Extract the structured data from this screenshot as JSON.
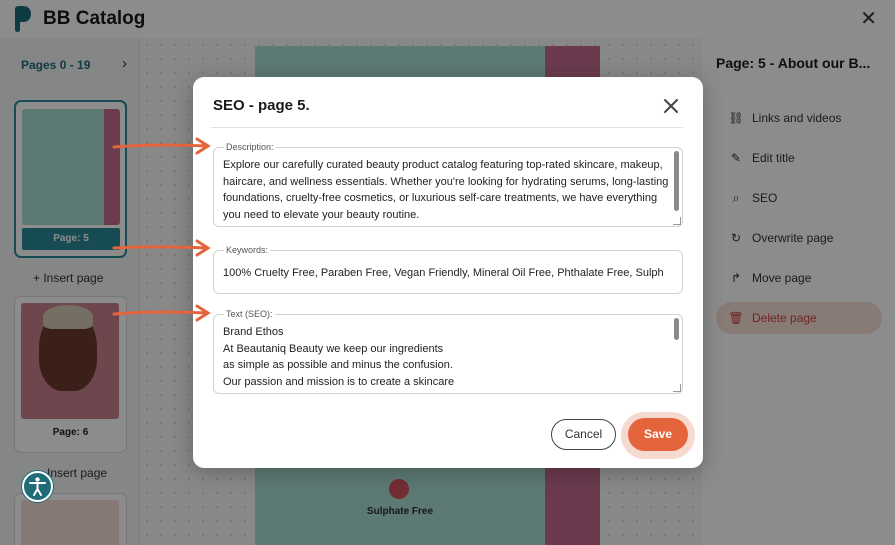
{
  "app": {
    "title": "BB Catalog",
    "brand_color": "#1c6d7c",
    "accent_color": "#e4643c"
  },
  "left_panel": {
    "pages_range": "Pages 0 - 19",
    "next_icon": "chevron-right-icon",
    "thumbnails": [
      {
        "label": "Page: 5",
        "active": true
      },
      {
        "label": "Page: 6",
        "active": false
      }
    ],
    "insert_page_label": "+ Insert page",
    "insert_page_label_2": "Insert page"
  },
  "canvas": {
    "preview_label": "Sulphate Free"
  },
  "right_panel": {
    "title": "Page: 5 - About our B...",
    "items": [
      {
        "label": "Links and videos",
        "icon": "link-icon"
      },
      {
        "label": "Edit title",
        "icon": "pencil-icon"
      },
      {
        "label": "SEO",
        "icon": "search-icon"
      },
      {
        "label": "Overwrite page",
        "icon": "refresh-icon"
      },
      {
        "label": "Move page",
        "icon": "move-icon"
      },
      {
        "label": "Delete page",
        "icon": "trash-icon"
      }
    ]
  },
  "modal": {
    "title": "SEO - page 5.",
    "description": {
      "label": "Description:",
      "value": "Explore our carefully curated beauty product catalog featuring top-rated skincare, makeup, haircare, and wellness essentials. Whether you're looking for hydrating serums, long-lasting foundations, cruelty-free cosmetics, or luxurious self-care treatments, we have everything you need to elevate your beauty routine."
    },
    "keywords": {
      "label": "Keywords:",
      "value": "100% Cruelty Free, Paraben Free, Vegan Friendly, Mineral Oil Free, Phthalate Free, Sulph"
    },
    "text_seo": {
      "label": "Text (SEO):",
      "lines": [
        "Brand Ethos",
        "At Beautaniq Beauty we keep our ingredients",
        "as simple as possible and minus the confusion.",
        "Our passion and mission is to create a skincare"
      ]
    },
    "cancel_label": "Cancel",
    "save_label": "Save"
  }
}
